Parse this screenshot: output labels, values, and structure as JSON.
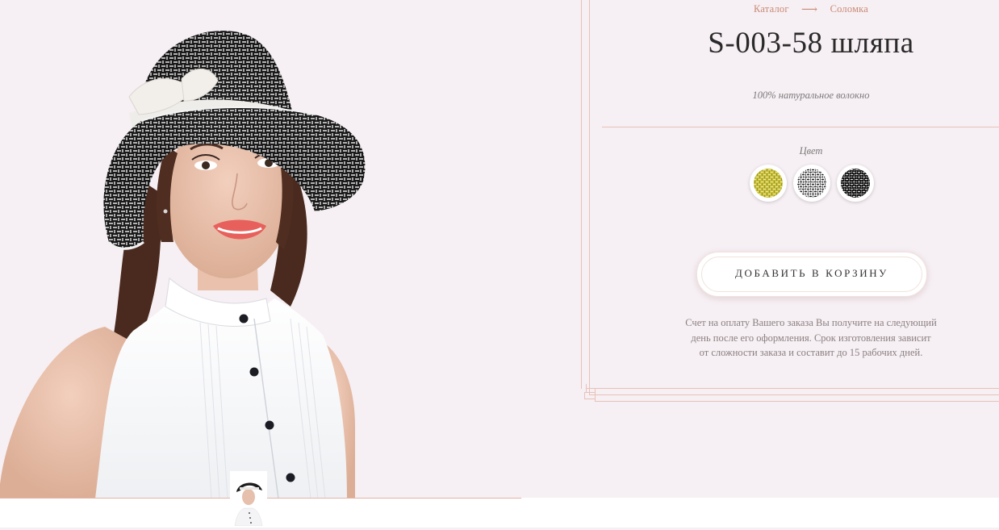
{
  "breadcrumb": {
    "catalog": "Каталог",
    "arrow": "⟶",
    "category": "Соломка"
  },
  "product": {
    "title": "S-003-58 шляпа",
    "material": "100% натуральное волокно"
  },
  "colors": {
    "label": "Цвет",
    "options": [
      {
        "name": "yellow-swatch",
        "hex": "#c9c23f"
      },
      {
        "name": "black-white-swatch",
        "hex": "#8a8a8a"
      },
      {
        "name": "black-swatch",
        "hex": "#1e1e1e"
      }
    ]
  },
  "cart": {
    "button_label": "ДОБАВИТЬ В КОРЗИНУ"
  },
  "info": {
    "line1": "Счет на оплату Вашего заказа Вы получите на следующий",
    "line2": "день после его оформления. Срок изготовления зависит",
    "line3": "от сложности заказа и составит до 15 рабочих дней."
  },
  "theme": {
    "accent": "#c98b76",
    "background": "#f6eff3",
    "frame": "#e8c2b7"
  }
}
